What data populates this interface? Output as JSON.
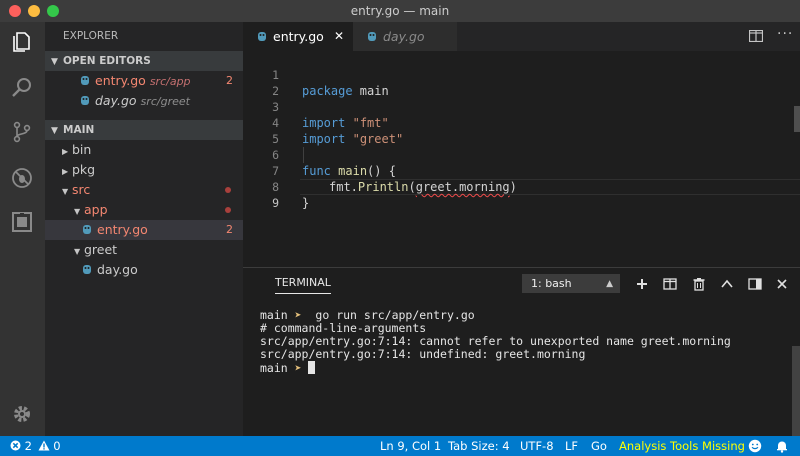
{
  "window": {
    "title": "entry.go — main"
  },
  "activity_bar": {
    "icons": [
      "files-icon",
      "search-icon",
      "source-control-icon",
      "debug-icon",
      "extensions-icon",
      "gear-icon"
    ]
  },
  "sidebar": {
    "title": "EXPLORER",
    "open_editors": {
      "header": "OPEN EDITORS",
      "items": [
        {
          "name": "entry.go",
          "path": "src/app",
          "badge": "2"
        },
        {
          "name": "day.go",
          "path": "src/greet"
        }
      ]
    },
    "folder": {
      "header": "MAIN",
      "items": [
        {
          "label": "bin"
        },
        {
          "label": "pkg"
        },
        {
          "label": "src"
        },
        {
          "label": "app"
        },
        {
          "label": "entry.go",
          "badge": "2"
        },
        {
          "label": "greet"
        },
        {
          "label": "day.go"
        }
      ]
    }
  },
  "tabs": [
    {
      "label": "entry.go",
      "close": "✕"
    },
    {
      "label": "day.go"
    }
  ],
  "editor": {
    "line_numbers": [
      "1",
      "2",
      "3",
      "4",
      "5",
      "6",
      "7",
      "8",
      "9"
    ],
    "tokens": {
      "l1_kw": "package",
      "l1_rest": " main",
      "l3_kw": "import",
      "l3_str": "\"fmt\"",
      "l4_kw": "import",
      "l4_str": "\"greet\"",
      "l6_kw": "func",
      "l6_fn": "main",
      "l6_rest": "() {",
      "l7_obj": "fmt.",
      "l7_fn": "Println",
      "l7_paren": "(",
      "l7_arg": "greet.morning",
      "l7_close": ")",
      "l8": "}"
    }
  },
  "panel": {
    "title": "TERMINAL",
    "terminal_select": "1: bash",
    "lines": [
      {
        "prompt": "main",
        "arrow": "➤",
        "text": "  go run src/app/entry.go"
      },
      {
        "text": "# command-line-arguments"
      },
      {
        "text": "src/app/entry.go:7:14: cannot refer to unexported name greet.morning"
      },
      {
        "text": "src/app/entry.go:7:14: undefined: greet.morning"
      },
      {
        "prompt": "main",
        "arrow": "➤",
        "text": ""
      }
    ]
  },
  "statusbar": {
    "errors": "2",
    "warnings": "0",
    "position": "Ln 9, Col 1",
    "tab_size": "Tab Size: 4",
    "encoding": "UTF-8",
    "eol": "LF",
    "language": "Go",
    "analysis": "Analysis Tools Missing"
  }
}
